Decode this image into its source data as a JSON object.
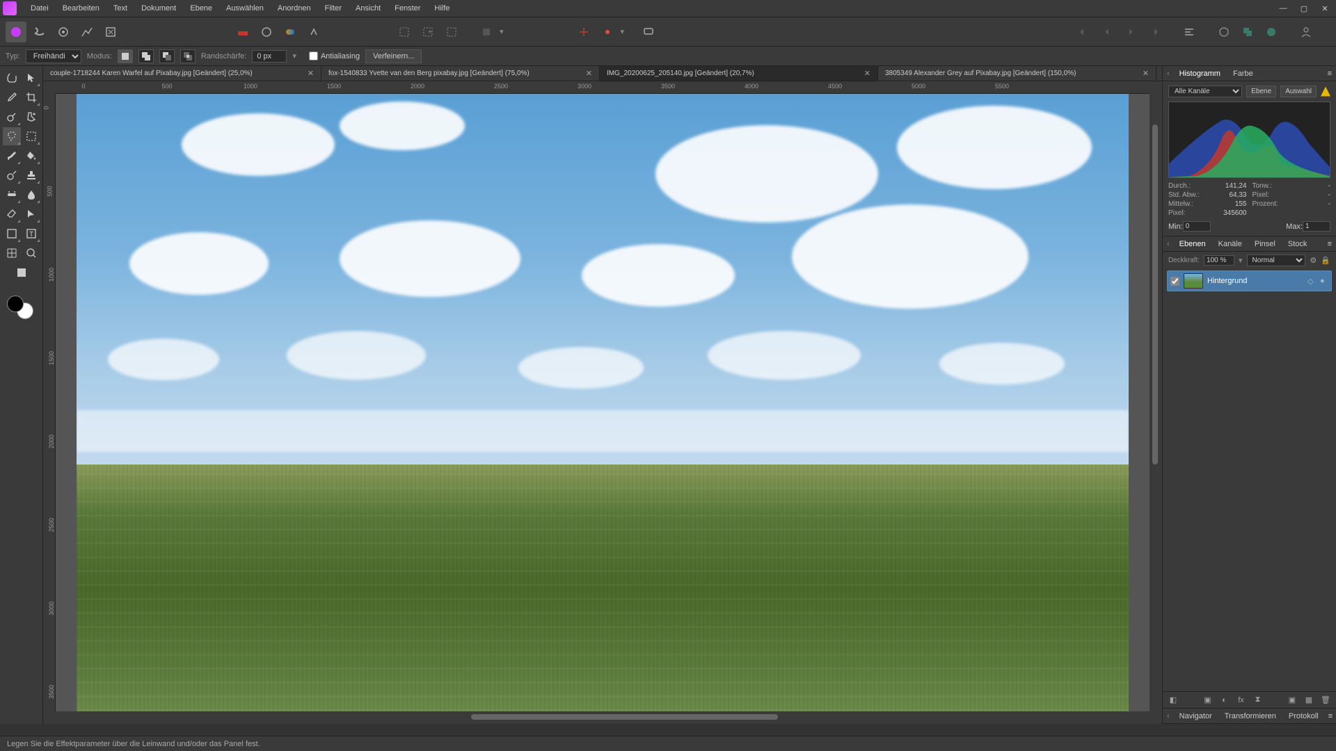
{
  "menu": [
    "Datei",
    "Bearbeiten",
    "Text",
    "Dokument",
    "Ebene",
    "Auswählen",
    "Anordnen",
    "Filter",
    "Ansicht",
    "Fenster",
    "Hilfe"
  ],
  "context": {
    "typ_label": "Typ:",
    "typ_value": "Freihändig",
    "modus_label": "Modus:",
    "feather_label": "Randschärfe:",
    "feather_value": "0 px",
    "antialias_label": "Antialiasing",
    "refine_label": "Verfeinern..."
  },
  "tabs": [
    {
      "title": "couple-1718244 Karen Warfel auf Pixabay.jpg [Geändert] (25,0%)"
    },
    {
      "title": "fox-1540833 Yvette van den Berg pixabay.jpg [Geändert] (75,0%)"
    },
    {
      "title": "IMG_20200625_205140.jpg [Geändert] (20,7%)"
    },
    {
      "title": "3805349 Alexander Grey auf Pixabay.jpg [Geändert] (150,0%)"
    }
  ],
  "active_tab": 2,
  "ruler_h": [
    "0",
    "500",
    "1000",
    "1500",
    "2000",
    "2500",
    "3000",
    "3500",
    "4000",
    "4500",
    "5000",
    "5500"
  ],
  "ruler_v": [
    "0",
    "500",
    "1000",
    "1500",
    "2000",
    "2500",
    "3000",
    "3500"
  ],
  "histogram_panel": {
    "tabs": [
      "Histogramm",
      "Farbe"
    ],
    "channel_label": "Alle Kanäle",
    "btn_ebene": "Ebene",
    "btn_auswahl": "Auswahl",
    "stats": {
      "durch_lbl": "Durch.:",
      "durch_val": "141,24",
      "tonw_lbl": "Tonw.:",
      "tonw_val": "-",
      "std_lbl": "Std. Abw.:",
      "std_val": "64,33",
      "pixel2_lbl": "Pixel:",
      "pixel2_val": "-",
      "mittel_lbl": "Mittelw.:",
      "mittel_val": "155",
      "proz_lbl": "Prozent:",
      "proz_val": "-",
      "pixel_lbl": "Pixel:",
      "pixel_val": "345600"
    },
    "min_lbl": "Min:",
    "min_val": "0",
    "max_lbl": "Max:",
    "max_val": "1"
  },
  "layers_panel": {
    "tabs": [
      "Ebenen",
      "Kanäle",
      "Pinsel",
      "Stock"
    ],
    "opacity_lbl": "Deckkraft:",
    "opacity_val": "100 %",
    "blend_mode": "Normal",
    "layer_name": "Hintergrund"
  },
  "bottom_tabs": [
    "Navigator",
    "Transformieren",
    "Protokoll"
  ],
  "statusbar": "Legen Sie die Effektparameter über die Leinwand und/oder das Panel fest."
}
